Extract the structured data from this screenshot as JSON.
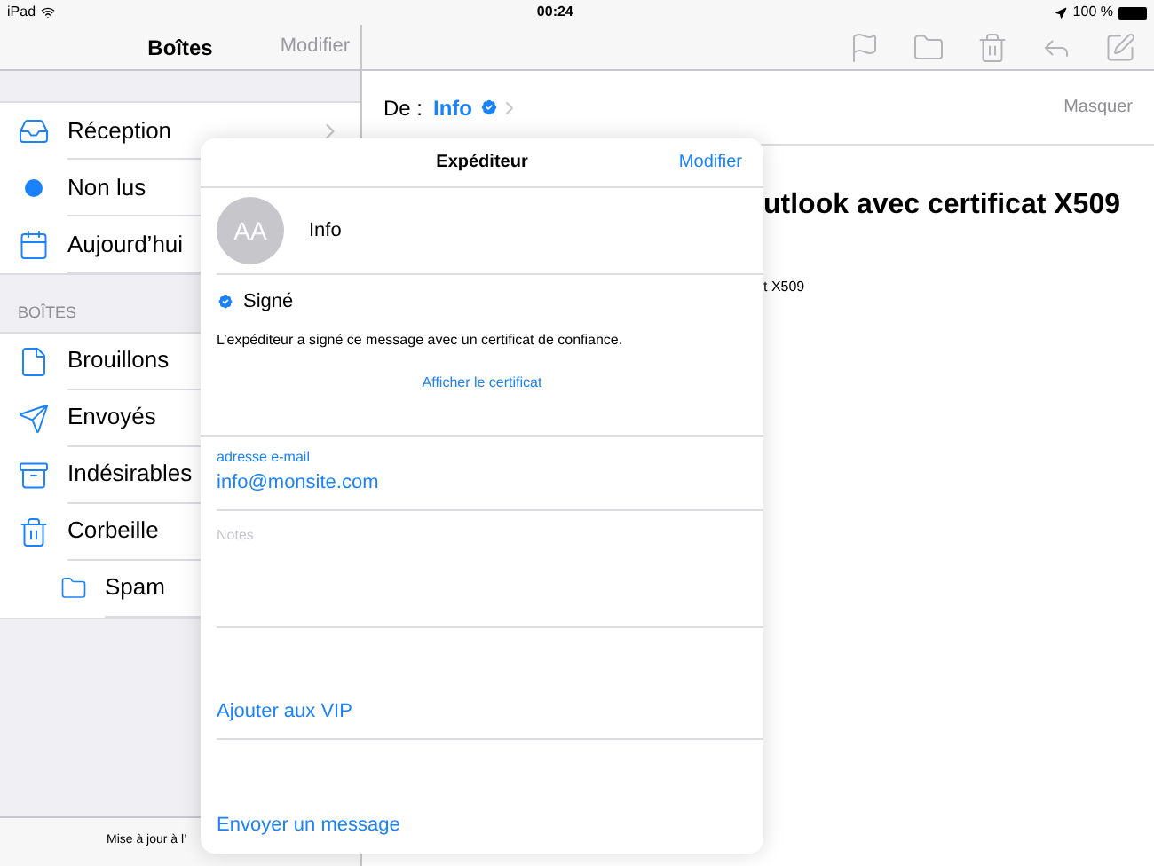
{
  "status_bar": {
    "device": "iPad",
    "time": "00:24",
    "battery": "100 %"
  },
  "sidebar": {
    "title": "Boîtes",
    "edit": "Modifier",
    "section_header": "BOÎTES",
    "footer": "Mise à jour à l’",
    "items": [
      {
        "kind": "inbox",
        "label": "Réception",
        "chevron": true
      },
      {
        "kind": "unread",
        "label": "Non lus"
      },
      {
        "kind": "today",
        "label": "Aujourd’hui"
      }
    ],
    "mailboxes": [
      {
        "kind": "drafts",
        "label": "Brouillons"
      },
      {
        "kind": "sent",
        "label": "Envoyés"
      },
      {
        "kind": "junk",
        "label": "Indésirables"
      },
      {
        "kind": "trash",
        "label": "Corbeille",
        "children": [
          {
            "kind": "folder",
            "label": "Spam"
          }
        ]
      }
    ]
  },
  "message": {
    "from_label": "De :",
    "from": "Info",
    "hide": "Masquer",
    "subject": "utlook avec certificat X509",
    "body": "t X509"
  },
  "popover": {
    "title": "Expéditeur",
    "edit": "Modifier",
    "initials": "AA",
    "name": "Info",
    "signed": "Signé",
    "signed_text": "L’expéditeur a signé ce message avec un certificat de confiance.",
    "show_cert": "Afficher le certificat",
    "email_label": "adresse e-mail",
    "email": "info@monsite.com",
    "notes_placeholder": "Notes",
    "actions": [
      "Ajouter aux VIP",
      "Envoyer un message"
    ]
  }
}
